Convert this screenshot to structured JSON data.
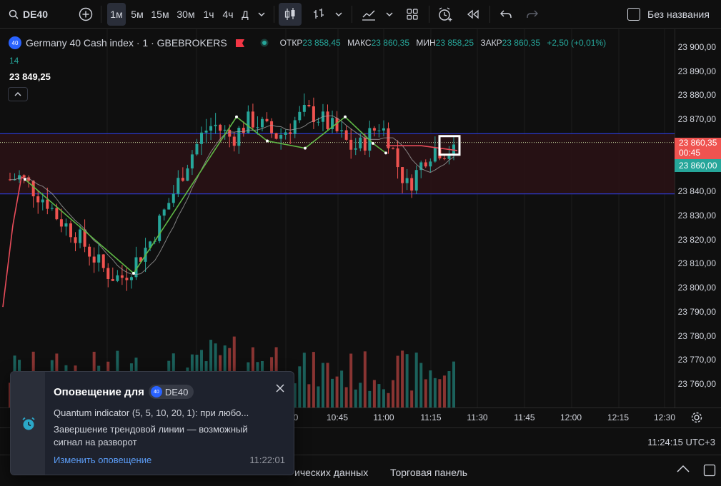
{
  "toolbar": {
    "symbol": "DE40",
    "intervals": [
      "1м",
      "5м",
      "15м",
      "30м",
      "1ч",
      "4ч",
      "Д"
    ],
    "active_interval": "1м",
    "layout_name": "Без названия"
  },
  "legend": {
    "instrument": "Germany 40 Cash index · 1 · GBEBROKERS",
    "badge": "40",
    "indicator_value": "14",
    "last_level": "23 849,25",
    "open_label": "ОТКР",
    "open": "23 858,45",
    "high_label": "МАКС",
    "high": "23 860,35",
    "low_label": "МИН",
    "low": "23 858,25",
    "close_label": "ЗАКР",
    "close": "23 860,35",
    "change": "+2,50 (+0,01%)"
  },
  "price_axis": {
    "ticks": [
      "23 900,00",
      "23 890,00",
      "23 880,00",
      "23 870,00",
      "23 840,00",
      "23 830,00",
      "23 820,00",
      "23 810,00",
      "23 800,00",
      "23 790,00",
      "23 780,00",
      "23 770,00",
      "23 760,00"
    ],
    "current_price": "23 860,35",
    "countdown": "00:45",
    "green_tag": "23 860,00"
  },
  "time_axis": {
    "ticks": [
      "0",
      "10:45",
      "11:00",
      "11:15",
      "11:30",
      "11:45",
      "12:00",
      "12:15",
      "12:30"
    ]
  },
  "status_bar": {
    "clock": "11:24:15 UTC+3"
  },
  "bottom_tabs": [
    "ических данных",
    "Торговая панель"
  ],
  "alert": {
    "title": "Оповещение для",
    "symbol": "DE40",
    "badge": "40",
    "line1": "Quantum indicator (5, 5, 10, 20, 1): при любо...",
    "line2": "Завершение трендовой линии — возможный сигнал на разворот",
    "link": "Изменить оповещение",
    "time": "11:22:01"
  },
  "colors": {
    "up": "#26a69a",
    "down": "#ef5350",
    "accent": "#2962ff",
    "zigzag": "#5fb845",
    "band_line": "#2d38c9"
  },
  "chart_data": {
    "type": "candlestick",
    "ylim": [
      23755,
      23903
    ],
    "price_ticks": [
      23900,
      23890,
      23880,
      23870,
      23840,
      23830,
      23820,
      23810,
      23800,
      23790,
      23780,
      23770,
      23760
    ],
    "current_price": 23860.35,
    "band_upper": 23864,
    "band_lower": 23839,
    "zigzag": [
      [
        35,
        23845
      ],
      [
        187,
        23806
      ],
      [
        331,
        23871
      ],
      [
        374,
        23861
      ],
      [
        427,
        23858
      ],
      [
        483,
        23871
      ],
      [
        522,
        23860
      ],
      [
        540,
        23856
      ]
    ],
    "close_path": [
      23845,
      23846,
      23843,
      23839,
      23836,
      23830,
      23826,
      23823,
      23818,
      23813,
      23808,
      23805,
      23804,
      23808,
      23813,
      23818,
      23826,
      23834,
      23842,
      23851,
      23858,
      23865,
      23868,
      23865,
      23862,
      23866,
      23870,
      23868,
      23865,
      23863,
      23866,
      23870,
      23873,
      23872,
      23869,
      23866,
      23862,
      23858,
      23859,
      23864,
      23868,
      23862,
      23850,
      23842,
      23848,
      23855,
      23858,
      23857,
      23856
    ]
  }
}
